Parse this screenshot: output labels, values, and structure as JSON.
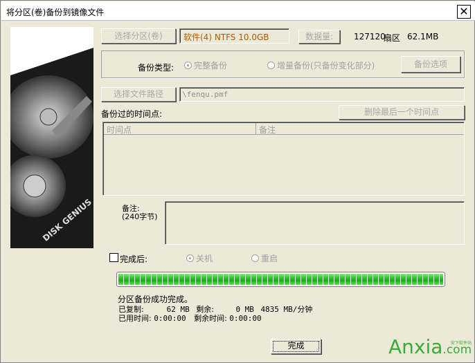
{
  "window": {
    "title": "将分区(卷)备份到镜像文件",
    "close_icon": "close-icon"
  },
  "image": {
    "brand": "DISK GENIUS"
  },
  "partition": {
    "button": "选择分区(卷)",
    "value": "软件(4) NTFS 10.0GB",
    "value_color": "#B05A00",
    "data_button": "数据量:",
    "sectors": "127120",
    "sectors_unit": "扇区",
    "size": "62.1MB"
  },
  "backup_type": {
    "label": "备份类型:",
    "full": "完整备份",
    "incremental": "增量备份(只备份变化部分)",
    "options_button": "备份选项",
    "selected": "full"
  },
  "path": {
    "button": "选择文件路径",
    "value": "\\fenqu.pmf"
  },
  "timepoints": {
    "label": "备份过的时间点:",
    "delete_button": "删除最后一个时间点",
    "columns": [
      "时间点",
      "备注"
    ],
    "rows": []
  },
  "note": {
    "label": "备注:",
    "hint": "(240字节)",
    "value": ""
  },
  "after": {
    "label": "完成后:",
    "checked": false,
    "shutdown": "关机",
    "restart": "重启",
    "selected": "shutdown"
  },
  "progress": {
    "percent": 100,
    "status": "分区备份成功完成。"
  },
  "stats": {
    "copied_label": "已复制:",
    "copied": "62 MB",
    "remaining_label": "剩余:",
    "remaining": "0 MB",
    "speed": "4835 MB/分钟",
    "elapsed_label": "已用时间:",
    "elapsed": "0:00:00",
    "left_label": "剩余时间:",
    "left": "0:00:00"
  },
  "finish_button": "完成",
  "watermark": {
    "text": "Anxia",
    "suffix": ".com",
    "tag": "安下软件站",
    "color": "#3BAA3B"
  }
}
